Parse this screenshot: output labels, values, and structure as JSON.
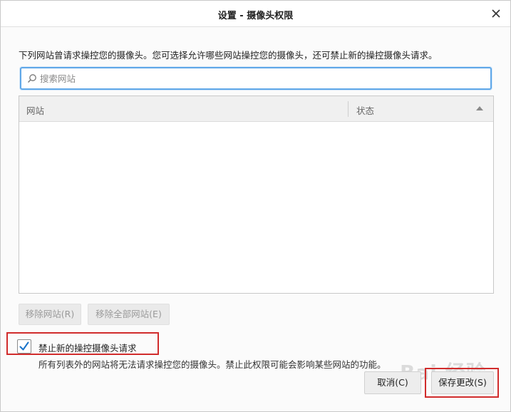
{
  "dialog": {
    "title": "设置 - 摄像头权限"
  },
  "description": "下列网站曾请求操控您的摄像头。您可选择允许哪些网站操控您的摄像头，还可禁止新的操控摄像头请求。",
  "search": {
    "placeholder": "搜索网站",
    "value": ""
  },
  "table": {
    "columns": [
      "网站",
      "状态"
    ],
    "rows": []
  },
  "buttons": {
    "remove_site": "移除网站(R)",
    "remove_all_sites": "移除全部网站(E)",
    "cancel": "取消(C)",
    "save": "保存更改(S)"
  },
  "block_new": {
    "label": "禁止新的操控摄像头请求",
    "checked": true
  },
  "note": "所有列表外的网站将无法请求操控您的摄像头。禁止此权限可能会影响某些网站的功能。",
  "colors": {
    "focus_border": "#5fa7e8",
    "highlight": "#d12c2c",
    "checkmark": "#1a73c9"
  }
}
